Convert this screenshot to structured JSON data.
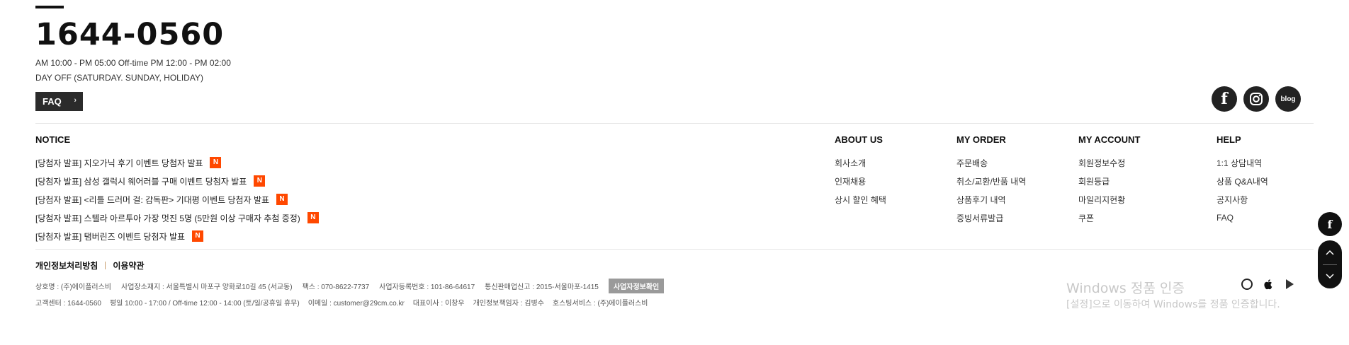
{
  "contact": {
    "phone": "1644-0560",
    "hours": "AM 10:00 - PM 05:00  Off-time PM 12:00 - PM 02:00",
    "day_off": "DAY OFF (SATURDAY. SUNDAY, HOLIDAY)",
    "faq_label": "FAQ"
  },
  "social": {
    "facebook_icon": "facebook-icon",
    "instagram_icon": "instagram-icon",
    "blog_label": "blog"
  },
  "notice": {
    "title": "NOTICE",
    "badge": "N",
    "items": [
      "[당첨자 발표] 지오가닉 후기 이벤트 당첨자 발표",
      "[당첨자 발표] 삼성 갤럭시 웨어러블 구매 이벤트 당첨자 발표",
      "[당첨자 발표] <리틀 드러머 걸: 감독판> 기대평 이벤트 당첨자 발표",
      "[당첨자 발표] 스텔라 아르투아 가장 멋진 5명 (5만원 이상 구매자 추첨 증정)",
      "[당첨자 발표] 탬버린즈 이벤트 당첨자 발표"
    ]
  },
  "columns": {
    "about": {
      "title": "ABOUT US",
      "links": [
        "회사소개",
        "인재채용",
        "상시 할인 혜택"
      ]
    },
    "order": {
      "title": "MY ORDER",
      "links": [
        "주문배송",
        "취소/교환/반품 내역",
        "상품후기 내역",
        "증빙서류발급"
      ]
    },
    "account": {
      "title": "MY ACCOUNT",
      "links": [
        "회원정보수정",
        "회원등급",
        "마일리지현황",
        "쿠폰"
      ]
    },
    "help": {
      "title": "HELP",
      "links": [
        "1:1 상담내역",
        "상품 Q&A내역",
        "공지사항",
        "FAQ"
      ]
    }
  },
  "policy": {
    "privacy": "개인정보처리방침",
    "terms": "이용약관"
  },
  "business": {
    "company": "상호명 : (주)에이플러스비",
    "address": "사업장소재지 : 서울특별시 마포구 양화로10길 45 (서교동)",
    "fax": "팩스 : 070-8622-7737",
    "reg_no": "사업자등록번호 : 101-86-64617",
    "telecom": "통신판매업신고 : 2015-서울마포-1415",
    "verify_button": "사업자정보확인",
    "cs": "고객센터 : 1644-0560",
    "weekday": "평일 10:00 - 17:00 / Off-time 12:00 - 14:00 (토/일/공휴일 휴무)",
    "email": "이메일 : customer@29cm.co.kr",
    "ceo": "대표이사 : 이창우",
    "privacy_officer": "개인정보책임자 : 김병수",
    "hosting": "호스팅서비스 : (주)에이플러스비"
  },
  "watermark": {
    "line1": "Windows 정품 인증",
    "line2": "[설정]으로 이동하여 Windows를 정품 인증합니다."
  },
  "app_icons": [
    "circle-app-icon",
    "apple-icon",
    "google-play-icon"
  ],
  "side": {
    "facebook_icon": "facebook-icon",
    "scroll_up_icon": "chevron-up-icon",
    "scroll_down_icon": "chevron-down-icon"
  }
}
